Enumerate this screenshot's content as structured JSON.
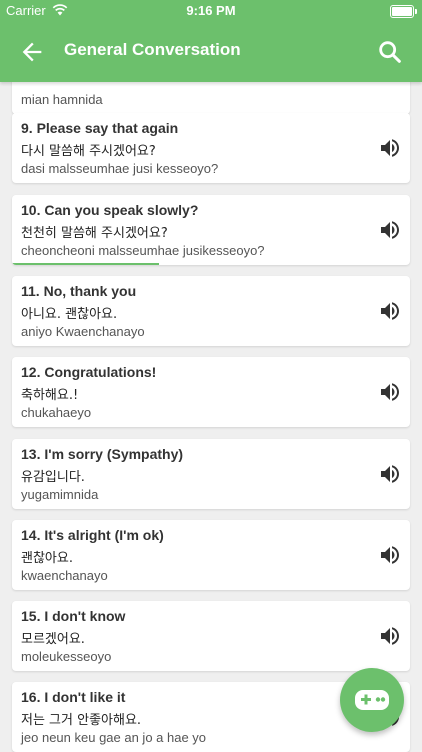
{
  "status_bar": {
    "carrier": "Carrier",
    "time": "9:16 PM"
  },
  "app_bar": {
    "title": "General Conversation"
  },
  "phrases": [
    {
      "en": "",
      "ko": "",
      "ro": "mian hamnida"
    },
    {
      "en": "9. Please say that again",
      "ko": "다시 말씀해 주시겠어요?",
      "ro": "dasi malsseumhae jusi kesseoyo?"
    },
    {
      "en": "10. Can you speak slowly?",
      "ko": "천천히 말씀해 주시겠어요?",
      "ro": "cheoncheoni malsseumhae jusikesseoyo?"
    },
    {
      "en": "11. No, thank you",
      "ko": "아니요. 괜찮아요.",
      "ro": "aniyo Kwaenchanayo"
    },
    {
      "en": "12. Congratulations!",
      "ko": "축하해요.!",
      "ro": "chukahaeyo"
    },
    {
      "en": "13. I'm sorry (Sympathy)",
      "ko": "유감입니다.",
      "ro": "yugamimnida"
    },
    {
      "en": "14. It's alright (I'm ok)",
      "ko": "괜찮아요.",
      "ro": "kwaenchanayo"
    },
    {
      "en": "15. I don't know",
      "ko": "모르겠어요.",
      "ro": "moleukesseoyo"
    },
    {
      "en": "16. I don't like it",
      "ko": "저는 그거 안좋아해요.",
      "ro": "jeo neun keu gae an jo a hae yo"
    }
  ],
  "playing": {
    "progress_fraction": 0.37
  },
  "colors": {
    "primary": "#6cc06c",
    "background": "#efefef"
  },
  "icons": {
    "back": "arrow-left-icon",
    "search": "search-icon",
    "speaker": "speaker-icon",
    "fab": "gamepad-icon"
  }
}
